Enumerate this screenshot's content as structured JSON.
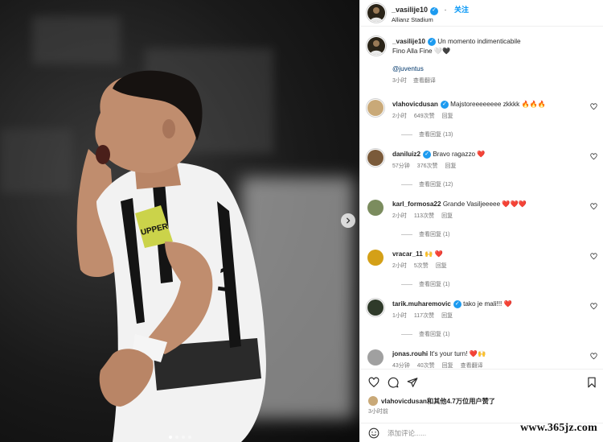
{
  "post": {
    "username": "_vasilije10",
    "follow_label": "关注",
    "separator": "·",
    "location": "Allianz Stadium",
    "caption_text": "Un momento indimenticabile",
    "caption_line2": "Fino Alla Fine 🤍🖤",
    "tag": "@juventus",
    "caption_time": "3小时",
    "translate_label": "查看翻译"
  },
  "comments": [
    {
      "user": "vlahovicdusan",
      "verified": true,
      "text": "Majstoreeeeeeee zkkkk 🔥🔥🔥",
      "time": "2小时",
      "likes": "649次赞",
      "reply": "回复",
      "view_replies": "查看回复 (13)",
      "avatar_color": "#c9a978"
    },
    {
      "user": "daniluiz2",
      "verified": true,
      "text": "Bravo ragazzo ❤️",
      "time": "57分钟",
      "likes": "376次赞",
      "reply": "回复",
      "view_replies": "查看回复 (12)",
      "avatar_color": "#7a5a3a"
    },
    {
      "user": "karl_formosa22",
      "verified": false,
      "text": "Grande Vasiljeeeee ❤️❤️❤️",
      "time": "2小时",
      "likes": "113次赞",
      "reply": "回复",
      "view_replies": "查看回复 (1)",
      "avatar_color": "#7b8c5e"
    },
    {
      "user": "vracar_11",
      "verified": false,
      "text": "🙌 ❤️",
      "time": "2小时",
      "likes": "5次赞",
      "reply": "回复",
      "view_replies": "查看回复 (1)",
      "avatar_color": "#d4a017"
    },
    {
      "user": "tarik.muharemovic",
      "verified": true,
      "text": "tako je mali!!! ❤️",
      "time": "1小时",
      "likes": "117次赞",
      "reply": "回复",
      "view_replies": "查看回复 (1)",
      "avatar_color": "#2f3a2a"
    },
    {
      "user": "jonas.rouhi",
      "verified": false,
      "text": "It's your turn! ❤️🙌",
      "time": "43分钟",
      "likes": "40次赞",
      "reply": "回复",
      "translate": "查看翻译",
      "avatar_color": "#a0a0a0"
    }
  ],
  "footer": {
    "likes_user": "vlahovicdusan",
    "likes_text": "和其他4.7万位用户赞了",
    "post_time": "3小时前",
    "add_comment_placeholder": "添加评论......"
  },
  "watermark": "www.365jz.com",
  "colors": {
    "accent": "#0095f6",
    "verified": "#1d9bf0",
    "heart": "#ed4956"
  },
  "icons": [
    "heart-icon",
    "comment-icon",
    "share-icon",
    "save-icon",
    "emoji-icon",
    "chevron-right-icon"
  ],
  "carousel": {
    "current": 1,
    "total": 4
  }
}
